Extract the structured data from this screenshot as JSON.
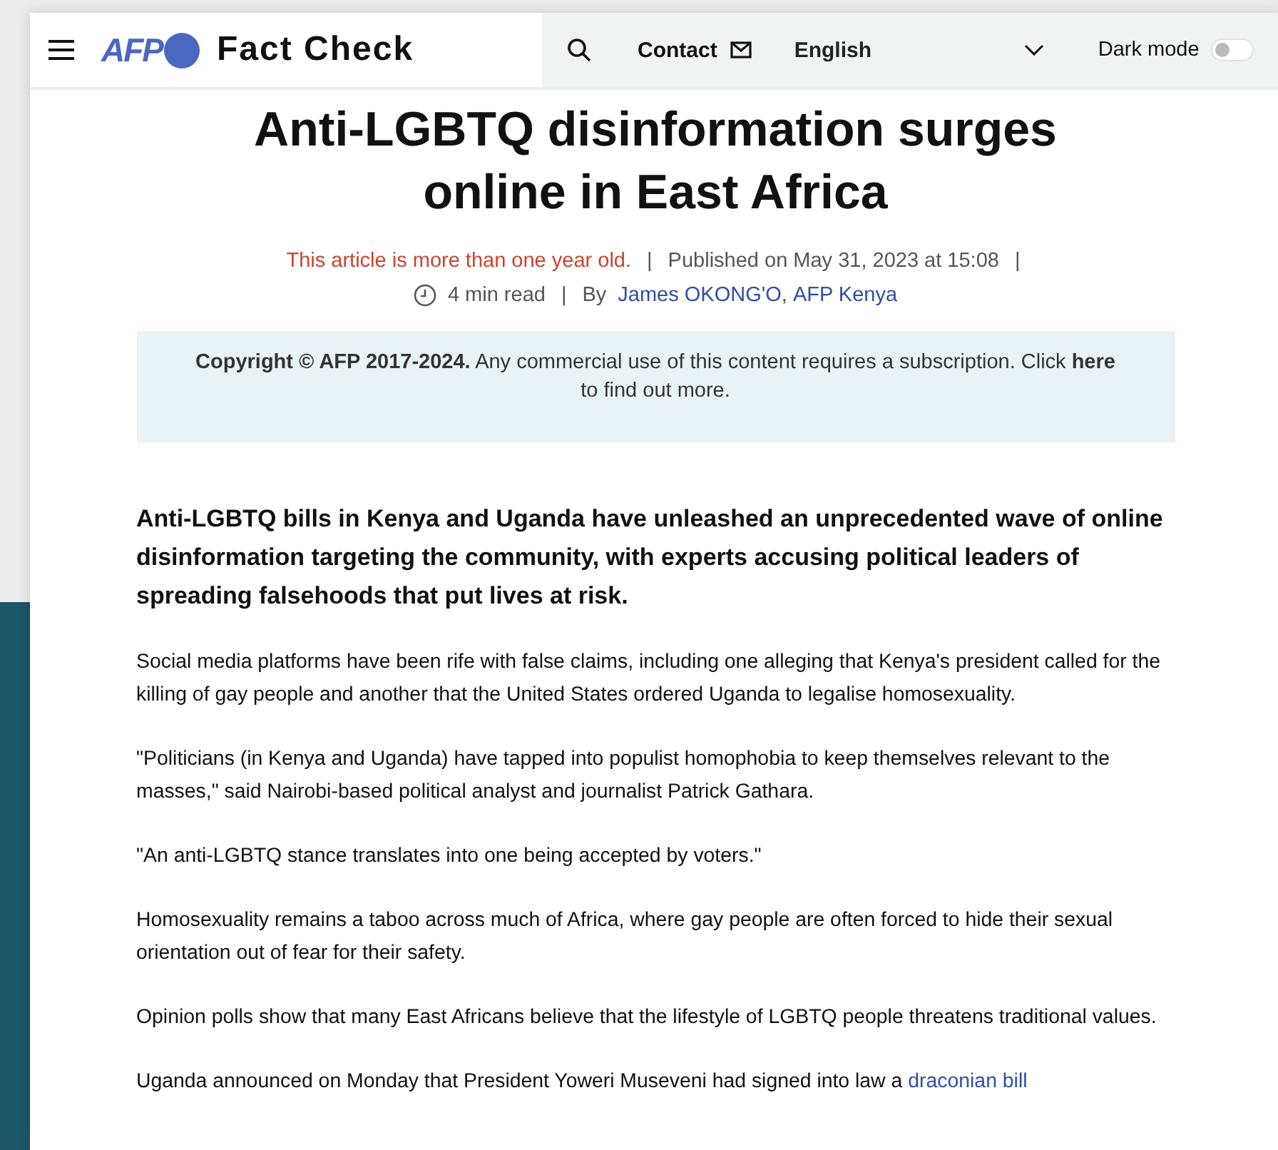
{
  "header": {
    "logo_text": "AFP",
    "title": "Fact Check",
    "contact": "Contact",
    "language": "English",
    "dark_mode": {
      "label": "Dark mode",
      "on": false
    }
  },
  "article": {
    "title": "Anti-LGBTQ disinformation surges online in East Africa",
    "age_notice": "This article is more than one year old.",
    "published": "Published on May 31, 2023 at 15:08",
    "read_time": "4 min read",
    "byline_prefix": "By",
    "separator": "|",
    "author_separator": ",",
    "authors": [
      "James OKONG'O",
      "AFP Kenya"
    ],
    "copyright": "**Copyright © AFP 2017-2024.** Any commercial use of this content requires a subscription. Click **here** to find out more.",
    "lead": "Anti-LGBTQ bills in Kenya and Uganda have unleashed an unprecedented wave of online disinformation targeting the community, with experts accusing political leaders of spreading falsehoods that put lives at risk.",
    "paragraphs": [
      {
        "text": "Social media platforms have been rife with false claims, including one alleging that Kenya's president called for the killing of gay people and another that the United States ordered Uganda to legalise homosexuality."
      },
      {
        "text": "\"Politicians (in Kenya and Uganda) have tapped into populist homophobia to keep themselves relevant to the masses,\" said Nairobi-based political analyst and journalist Patrick Gathara."
      },
      {
        "text": "\"An anti-LGBTQ stance translates into one being accepted by voters.\""
      },
      {
        "text": "Homosexuality remains a taboo across much of Africa, where gay people are often forced to hide their sexual orientation out of fear for their safety."
      },
      {
        "text": "Opinion polls show that many East Africans believe that the lifestyle of LGBTQ people threatens traditional values."
      },
      {
        "text": "Uganda announced on Monday that President Yoweri Museveni had signed into law a",
        "link": "draconian bill"
      }
    ]
  }
}
